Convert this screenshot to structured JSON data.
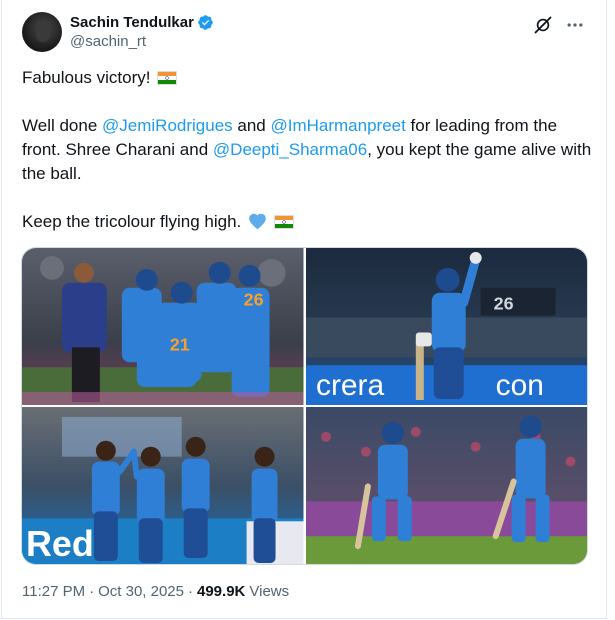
{
  "author": {
    "display_name": "Sachin Tendulkar",
    "handle": "@sachin_rt",
    "verified": true
  },
  "icons": {
    "verified_color": "#1d9bf0",
    "grok": "grok-icon",
    "more": "more-icon"
  },
  "tweet": {
    "line1": "Fabulous victory!",
    "p2_a": "Well done ",
    "mention1": "@JemiRodrigues",
    "p2_b": " and ",
    "mention2": "@ImHarmanpreet",
    "p2_c": " for leading from the front. Shree Charani and ",
    "mention3": "@Deepti_Sharma06",
    "p2_d": ", you kept the game alive with the ball.",
    "line3": "Keep the tricolour flying high."
  },
  "media": {
    "photo_count": 4,
    "banner_1": "crera",
    "banner_2": "con",
    "banner_3": "Reda",
    "jersey_1": "26",
    "jersey_2": "21",
    "scoreboard": "26"
  },
  "meta": {
    "time": "11:27 PM",
    "date": "Oct 30, 2025",
    "separator": "·",
    "views_count": "499.9K",
    "views_label": "Views"
  },
  "colors": {
    "mention": "#1d9bf0",
    "secondary_text": "#536471",
    "india_blue": "#1f6fd1"
  }
}
